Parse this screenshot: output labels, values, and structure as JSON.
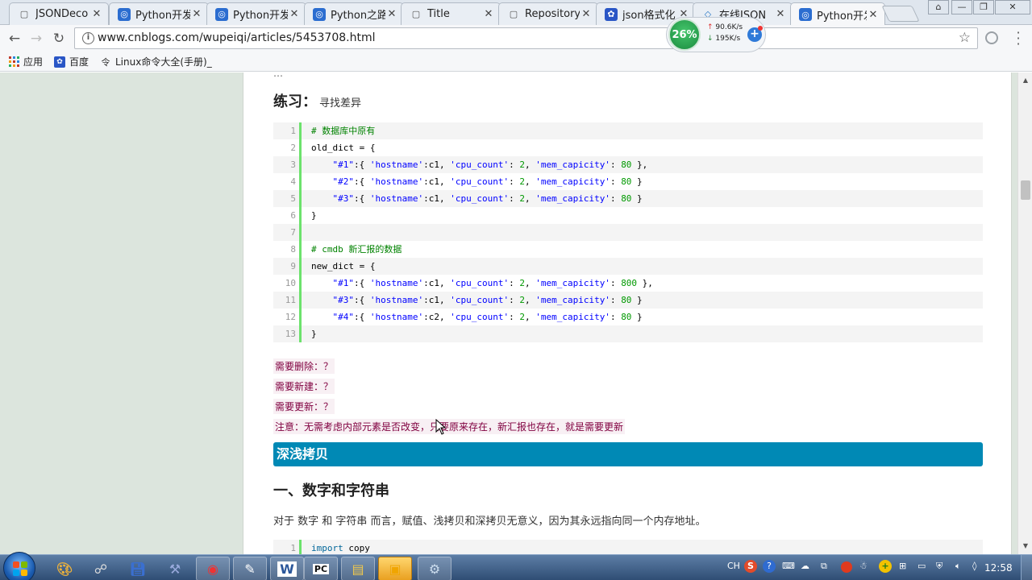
{
  "browser": {
    "tabs": [
      {
        "title": "JSONDeco",
        "icon": "document-icon",
        "active": false
      },
      {
        "title": "Python开发",
        "icon": "cnblogs-icon",
        "active": false
      },
      {
        "title": "Python开发",
        "icon": "cnblogs-icon",
        "active": false
      },
      {
        "title": "Python之路",
        "icon": "cnblogs-icon",
        "active": false
      },
      {
        "title": "Title",
        "icon": "document-icon",
        "active": false
      },
      {
        "title": "Repository",
        "icon": "document-icon",
        "active": false
      },
      {
        "title": "json格式化",
        "icon": "baidu-paw-icon",
        "active": false
      },
      {
        "title": "在线JSON",
        "icon": "json-code-icon",
        "active": false
      },
      {
        "title": "Python开发",
        "icon": "cnblogs-icon",
        "active": true
      }
    ],
    "url": "www.cnblogs.com/wupeiqi/articles/5453708.html",
    "bookmarks": [
      {
        "label": "应用",
        "icon": "apps-grid-icon"
      },
      {
        "label": "百度",
        "icon": "baidu-paw-icon"
      },
      {
        "label": "Linux命令大全(手册)_",
        "icon": "linux-cmd-icon"
      }
    ],
    "net_widget": {
      "percent": "26%",
      "up": "90.6K/s",
      "down": "195K/s"
    }
  },
  "article": {
    "exercise_title": "练习：",
    "exercise_subtitle": "寻找差异",
    "code1": [
      {
        "n": "1",
        "text": "# 数据库中原有"
      },
      {
        "n": "2",
        "text": "old_dict = {"
      },
      {
        "n": "3",
        "text": "    \"#1\":{ 'hostname':c1, 'cpu_count': 2, 'mem_capicity': 80 },"
      },
      {
        "n": "4",
        "text": "    \"#2\":{ 'hostname':c1, 'cpu_count': 2, 'mem_capicity': 80 }"
      },
      {
        "n": "5",
        "text": "    \"#3\":{ 'hostname':c1, 'cpu_count': 2, 'mem_capicity': 80 }"
      },
      {
        "n": "6",
        "text": "}"
      },
      {
        "n": "7",
        "text": ""
      },
      {
        "n": "8",
        "text": "# cmdb 新汇报的数据"
      },
      {
        "n": "9",
        "text": "new_dict = {"
      },
      {
        "n": "10",
        "text": "    \"#1\":{ 'hostname':c1, 'cpu_count': 2, 'mem_capicity': 800 },"
      },
      {
        "n": "11",
        "text": "    \"#3\":{ 'hostname':c1, 'cpu_count': 2, 'mem_capicity': 80 }"
      },
      {
        "n": "12",
        "text": "    \"#4\":{ 'hostname':c2, 'cpu_count': 2, 'mem_capicity': 80 }"
      },
      {
        "n": "13",
        "text": "}"
      }
    ],
    "q_delete": "需要删除：？",
    "q_new": "需要新建：？",
    "q_update": "需要更新：？",
    "q_note": "注意：无需考虑内部元素是否改变，只要原来存在，新汇报也存在，就是需要更新",
    "section_bar": "深浅拷贝",
    "heading_one": "一、数字和字符串",
    "paragraph": "对于 数字 和 字符串 而言，赋值、浅拷贝和深拷贝无意义，因为其永远指向同一个内存地址。",
    "code2": [
      {
        "n": "1",
        "text": "import copy"
      }
    ]
  },
  "taskbar": {
    "apps": [
      "paint-icon",
      "network-icon",
      "save-disk-icon",
      "tools-icon",
      "chrome-icon",
      "notepad-icon",
      "word-icon",
      "pycharm-icon",
      "explorer-folder-icon",
      "sticky-note-icon",
      "settings-app-icon"
    ],
    "tray_text": "CH",
    "clock": "12:58"
  }
}
